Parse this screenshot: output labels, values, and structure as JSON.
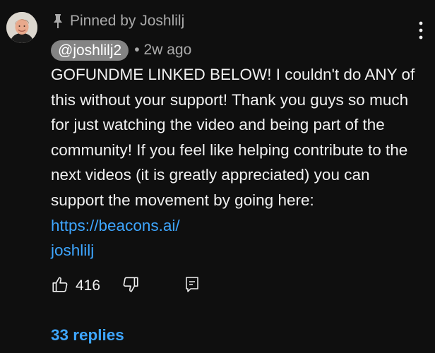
{
  "comment": {
    "pinned_label": "Pinned by Joshlilj",
    "author_handle": "@joshlilj2",
    "meta_separator": "•",
    "timestamp": "2w ago",
    "body_text": "GOFUNDME LINKED BELOW! I couldn't do ANY of this without your support! Thank you guys so much for just watching the video and being part of the community! If you feel like helping contribute to the next videos (it is greatly appreciated) you can support the movement by going here: ",
    "link_text": "https://beacons.ai/joshlilj",
    "link_display_part1": "https://beacons.ai/",
    "link_display_part2": "joshlilj",
    "like_count": "416",
    "replies_label": "33 replies"
  },
  "icons": {
    "avatar": "avatar",
    "pin": "pin-icon",
    "more": "more-vertical-icon",
    "like": "thumbs-up-icon",
    "dislike": "thumbs-down-icon",
    "reply": "reply-icon"
  },
  "colors": {
    "background": "#0f0f0f",
    "text_primary": "#f1f1f1",
    "text_secondary": "#aaaaaa",
    "link": "#3ea6ff",
    "author_chip": "#848484"
  }
}
